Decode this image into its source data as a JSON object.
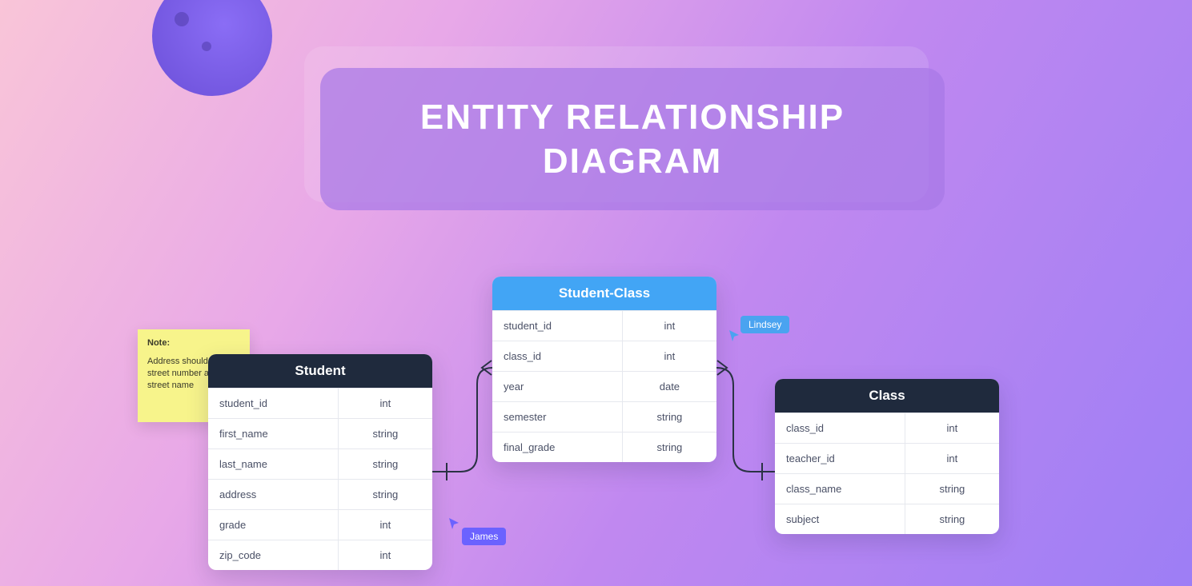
{
  "title": "ENTITY RELATIONSHIP DIAGRAM",
  "sticky_note": {
    "label": "Note:",
    "body": "Address should contain street number and street name"
  },
  "entities": {
    "student": {
      "name": "Student",
      "fields": [
        {
          "name": "student_id",
          "type": "int"
        },
        {
          "name": "first_name",
          "type": "string"
        },
        {
          "name": "last_name",
          "type": "string"
        },
        {
          "name": "address",
          "type": "string"
        },
        {
          "name": "grade",
          "type": "int"
        },
        {
          "name": "zip_code",
          "type": "int"
        }
      ]
    },
    "student_class": {
      "name": "Student-Class",
      "fields": [
        {
          "name": "student_id",
          "type": "int"
        },
        {
          "name": "class_id",
          "type": "int"
        },
        {
          "name": "year",
          "type": "date"
        },
        {
          "name": "semester",
          "type": "string"
        },
        {
          "name": "final_grade",
          "type": "string"
        }
      ]
    },
    "class": {
      "name": "Class",
      "fields": [
        {
          "name": "class_id",
          "type": "int"
        },
        {
          "name": "teacher_id",
          "type": "int"
        },
        {
          "name": "class_name",
          "type": "string"
        },
        {
          "name": "subject",
          "type": "string"
        }
      ]
    }
  },
  "cursors": {
    "lindsey": "Lindsey",
    "james": "James"
  }
}
